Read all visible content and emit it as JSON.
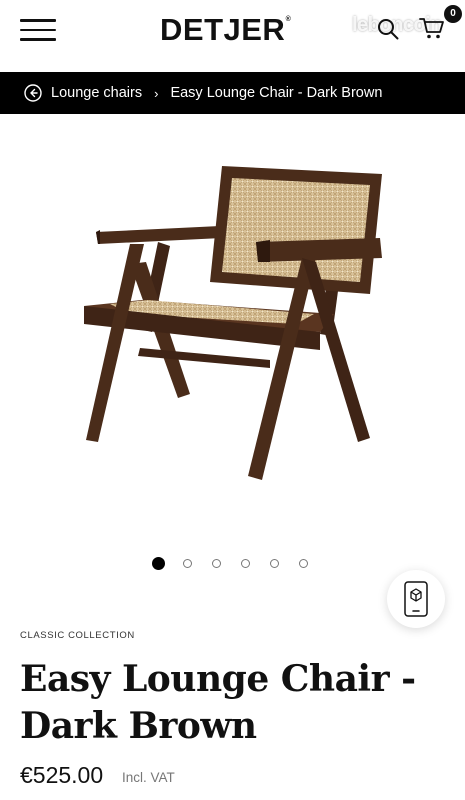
{
  "header": {
    "logo": "DETJER",
    "logo_mark": "®",
    "cart_count": "0",
    "watermark": "leboncoin",
    "icons": {
      "menu": "hamburger-menu-icon",
      "search": "search-icon",
      "cart": "cart-icon"
    }
  },
  "breadcrumb": {
    "back_icon": "circle-arrow-left-icon",
    "parent": "Lounge chairs",
    "separator": "›",
    "current": "Easy Lounge Chair - Dark Brown"
  },
  "gallery": {
    "slide_count": 6,
    "active_index": 0,
    "ar_icon": "ar-view-phone-icon",
    "colors": {
      "wood": "#4a2c1a",
      "cane": "#d9c29a"
    }
  },
  "product": {
    "collection": "CLASSIC COLLECTION",
    "title": "Easy Lounge Chair - Dark Brown",
    "price": "€525.00",
    "vat_note": "Incl. VAT"
  }
}
